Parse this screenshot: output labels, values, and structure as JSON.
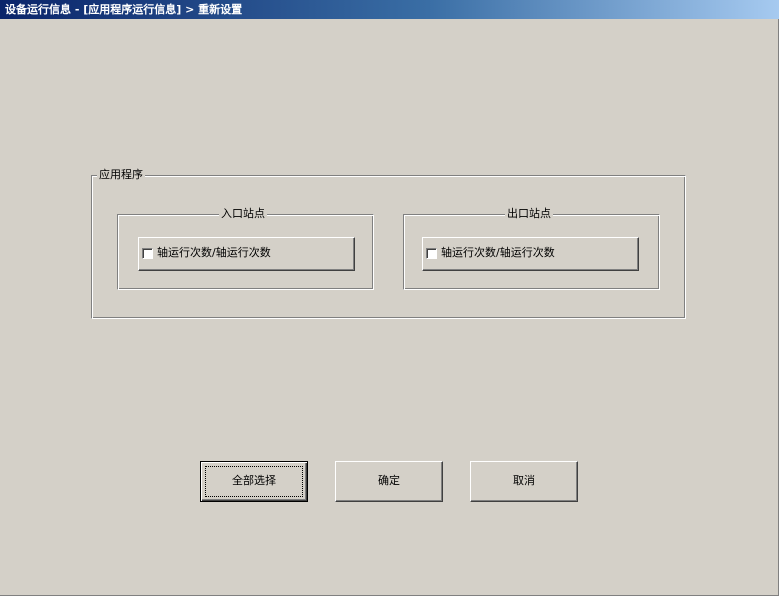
{
  "window": {
    "title": "设备运行信息 - [应用程序运行信息] > 重新设置"
  },
  "app_group": {
    "caption": "应用程序",
    "entry_group": {
      "caption": "入口站点",
      "checkbox_label": "轴运行次数/轴运行次数",
      "checked": false
    },
    "exit_group": {
      "caption": "出口站点",
      "checkbox_label": "轴运行次数/轴运行次数",
      "checked": false
    }
  },
  "buttons": {
    "select_all": "全部选择",
    "confirm": "确定",
    "cancel": "取消"
  }
}
